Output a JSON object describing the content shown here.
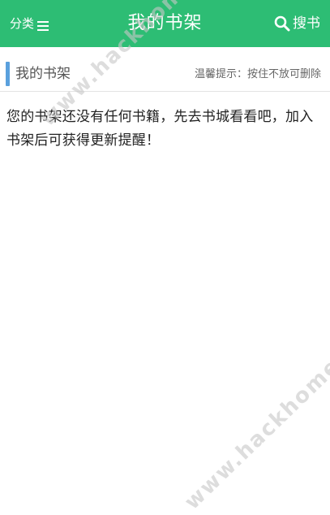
{
  "header": {
    "category_label": "分类",
    "title": "我的书架",
    "search_label": "搜书",
    "background_color": "#2dbd74",
    "icons": {
      "menu": "menu-icon",
      "search": "search-icon"
    }
  },
  "section": {
    "label": "我的书架",
    "tip": "温馨提示：按住不放可删除",
    "accent_color": "#5aa0dd"
  },
  "content": {
    "empty_message": "您的书架还没有任何书籍，先去书城看看吧，加入书架后可获得更新提醒！"
  },
  "watermark": {
    "text": "www.hackhome.com"
  }
}
